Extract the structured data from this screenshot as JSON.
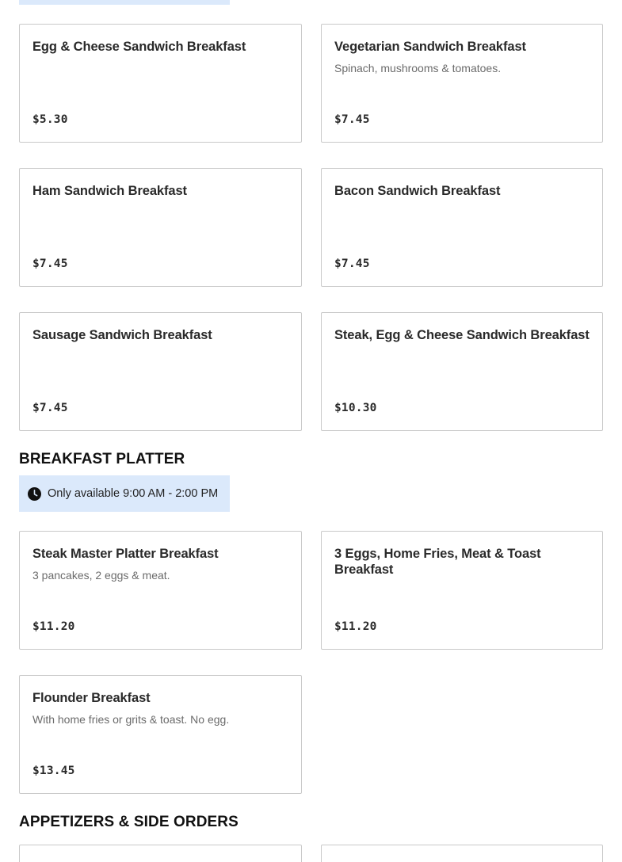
{
  "sections": {
    "sandwiches": {
      "items": [
        {
          "name": "Egg & Cheese Sandwich Breakfast",
          "description": "",
          "price": "$5.30"
        },
        {
          "name": "Vegetarian Sandwich Breakfast",
          "description": "Spinach, mushrooms & tomatoes.",
          "price": "$7.45"
        },
        {
          "name": "Ham Sandwich Breakfast",
          "description": "",
          "price": "$7.45"
        },
        {
          "name": "Bacon Sandwich Breakfast",
          "description": "",
          "price": "$7.45"
        },
        {
          "name": "Sausage Sandwich Breakfast",
          "description": "",
          "price": "$7.45"
        },
        {
          "name": "Steak, Egg & Cheese Sandwich Breakfast",
          "description": "",
          "price": "$10.30"
        }
      ]
    },
    "platter": {
      "title": "BREAKFAST PLATTER",
      "availability": "Only available 9:00 AM - 2:00 PM",
      "availability_icon": "clock-icon",
      "items": [
        {
          "name": "Steak Master Platter Breakfast",
          "description": "3 pancakes, 2 eggs & meat.",
          "price": "$11.20"
        },
        {
          "name": "3 Eggs, Home Fries, Meat & Toast Breakfast",
          "description": "",
          "price": "$11.20"
        },
        {
          "name": "Flounder Breakfast",
          "description": "With home fries or grits & toast. No egg.",
          "price": "$13.45"
        }
      ]
    },
    "appetizers": {
      "title": "APPETIZERS & SIDE ORDERS"
    }
  },
  "colors": {
    "availability_bg": "#dbe9fb",
    "card_border": "#c9c9c9",
    "text_dark": "#2a2a2a",
    "text_muted": "#6b6b6b"
  }
}
